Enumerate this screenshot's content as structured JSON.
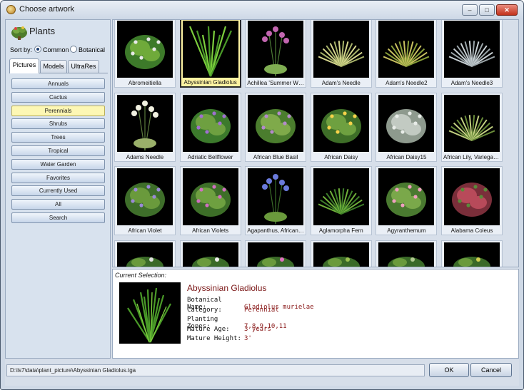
{
  "window": {
    "title": "Choose artwork"
  },
  "category": {
    "title": "Plants"
  },
  "sort": {
    "label": "Sort by:",
    "options": [
      "Common",
      "Botanical"
    ],
    "selected": "Common"
  },
  "tabs": [
    "Pictures",
    "Models",
    "UltraRes"
  ],
  "active_tab": "Pictures",
  "categories": [
    "Annuals",
    "Cactus",
    "Perennials",
    "Shrubs",
    "Trees",
    "Tropical",
    "Water Garden",
    "Favorites",
    "Currently Used",
    "All",
    "Search"
  ],
  "selected_category": "Perennials",
  "plants": [
    "Abromeitiella",
    "Abyssinian Gladiolus",
    "Achillea 'Summer Wine'",
    "Adam's Needle",
    "Adam's Needle2",
    "Adam's Needle3",
    "Adams Needle",
    "Adriatic Bellflower",
    "African Blue Basil",
    "African Daisy",
    "African Daisy15",
    "African Lily, Variegate...",
    "African Violet",
    "African Violets",
    "Agapanthus, African ...",
    "Aglamorpha Fern",
    "Agyranthemum",
    "Alabama Coleus",
    "",
    "",
    "",
    "",
    "",
    ""
  ],
  "selected_plant": "Abyssinian Gladiolus",
  "selection": {
    "caption": "Current Selection:",
    "name": "Abyssinian Gladiolus",
    "fields": [
      {
        "key": "Botanical Name:",
        "value": "Gladiolus murielae"
      },
      {
        "key": "Category:",
        "value": "Perennial"
      },
      {
        "key": "Planting Zones:",
        "value": "7,8,9,10,11"
      },
      {
        "key": "Mature Age:",
        "value": "3 years"
      },
      {
        "key": "Mature Height:",
        "value": "3'"
      }
    ]
  },
  "path": "D:\\ls7\\data\\plant_picture\\Abyssinian Gladiolus.tga",
  "buttons": {
    "ok": "OK",
    "cancel": "Cancel"
  },
  "icons": {
    "title": "artwork-icon",
    "category": "plant-icon"
  },
  "colors": {
    "selected_highlight": "#fdf3a2",
    "value_text": "#8a1a1a",
    "thumb_bg": "#000000"
  }
}
